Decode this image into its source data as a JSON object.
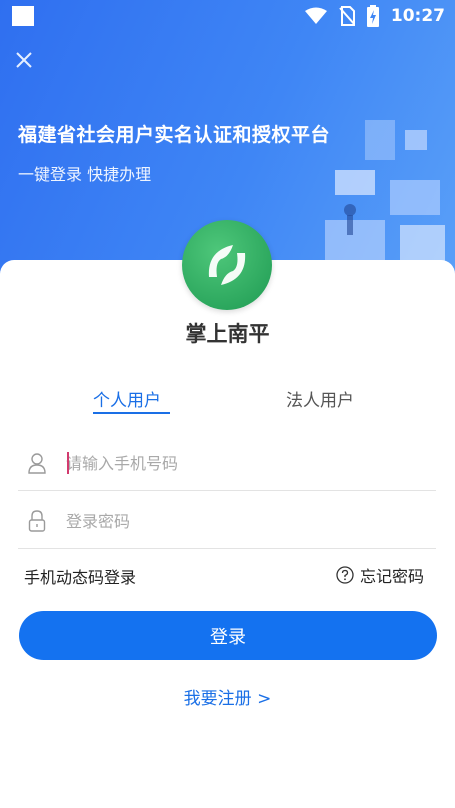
{
  "status_bar": {
    "time": "10:27",
    "icons": [
      "wifi-icon",
      "no-sim-icon",
      "battery-charging-icon"
    ]
  },
  "header": {
    "close_icon": "close-icon",
    "title": "福建省社会用户实名认证和授权平台",
    "subtitle": "一键登录 快捷办理"
  },
  "app": {
    "name": "掌上南平"
  },
  "tabs": [
    {
      "label": "个人用户",
      "active": true
    },
    {
      "label": "法人用户",
      "active": false
    }
  ],
  "form": {
    "phone": {
      "placeholder": "请输入手机号码",
      "value": "",
      "icon": "user-icon"
    },
    "password": {
      "placeholder": "登录密码",
      "value": "",
      "icon": "lock-icon"
    },
    "sms_login": "手机动态码登录",
    "forgot_password": "忘记密码",
    "login_button": "登录",
    "register_link": "我要注册 >"
  },
  "colors": {
    "primary": "#1472F0",
    "header_gradient_start": "#2F6FF0",
    "logo_green": "#2DAA5F"
  }
}
